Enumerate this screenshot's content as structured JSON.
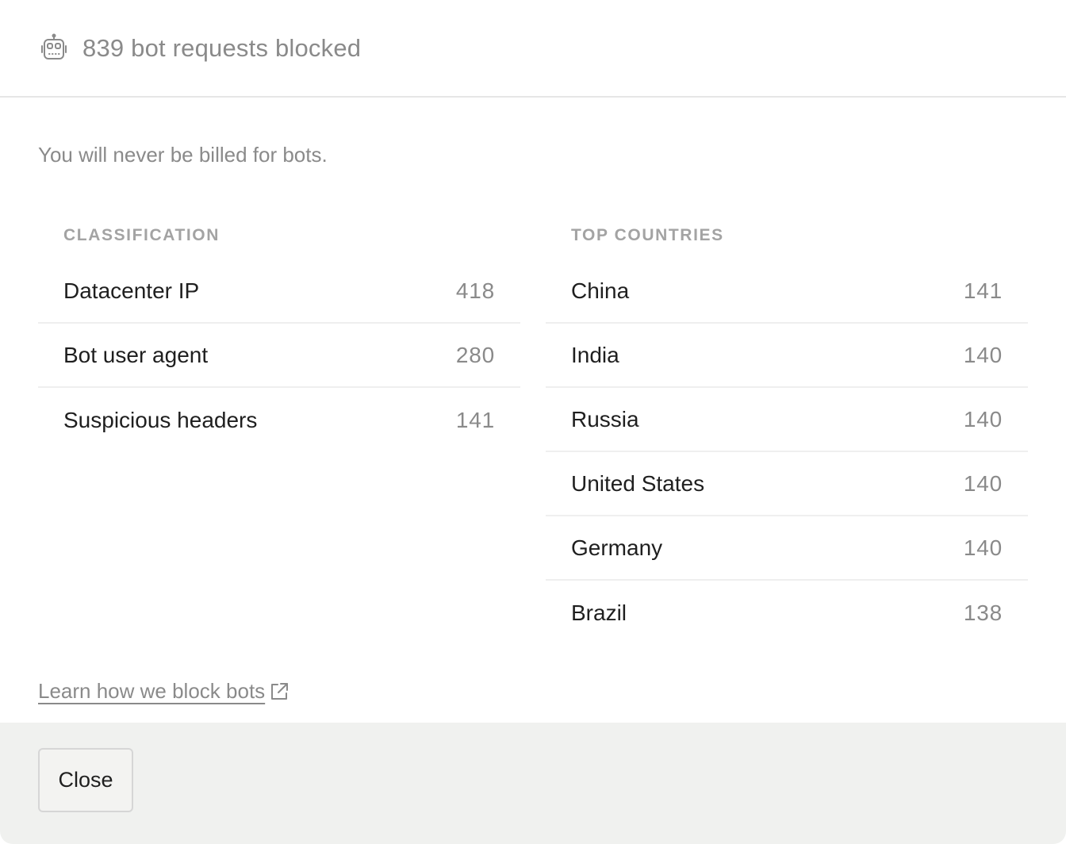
{
  "header": {
    "icon": "robot-icon",
    "title": "839 bot requests blocked"
  },
  "subtitle": "You will never be billed for bots.",
  "classification": {
    "header": "CLASSIFICATION",
    "rows": [
      {
        "label": "Datacenter IP",
        "value": "418"
      },
      {
        "label": "Bot user agent",
        "value": "280"
      },
      {
        "label": "Suspicious headers",
        "value": "141"
      }
    ]
  },
  "countries": {
    "header": "TOP COUNTRIES",
    "rows": [
      {
        "label": "China",
        "value": "141"
      },
      {
        "label": "India",
        "value": "140"
      },
      {
        "label": "Russia",
        "value": "140"
      },
      {
        "label": "United States",
        "value": "140"
      },
      {
        "label": "Germany",
        "value": "140"
      },
      {
        "label": "Brazil",
        "value": "138"
      }
    ]
  },
  "learn_link": {
    "label": "Learn how we block bots",
    "icon": "external-link-icon"
  },
  "footer": {
    "close_label": "Close"
  },
  "colors": {
    "muted_text": "#8a8a8a",
    "footer_bg": "#f0f1ef",
    "divider": "#e6e6e6"
  }
}
